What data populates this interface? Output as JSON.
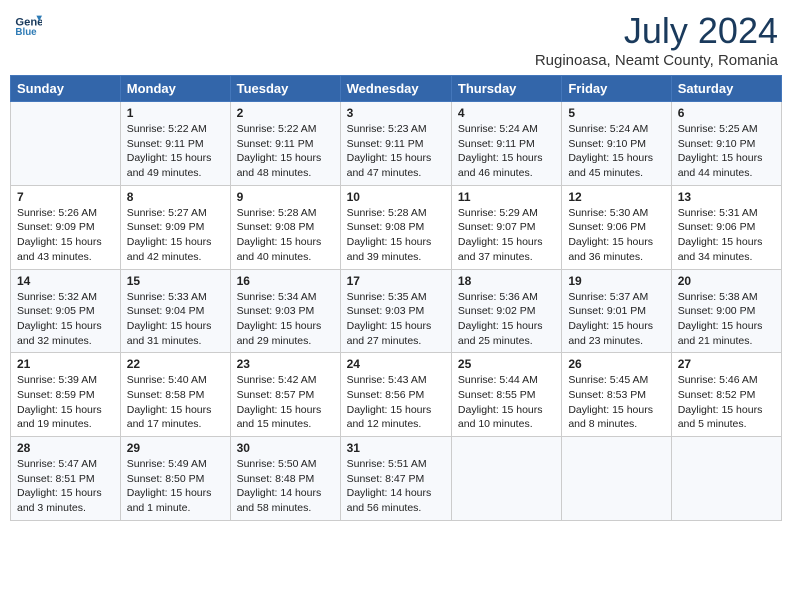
{
  "header": {
    "logo_line1": "General",
    "logo_line2": "Blue",
    "month_year": "July 2024",
    "location": "Ruginoasa, Neamt County, Romania"
  },
  "days_of_week": [
    "Sunday",
    "Monday",
    "Tuesday",
    "Wednesday",
    "Thursday",
    "Friday",
    "Saturday"
  ],
  "weeks": [
    [
      {
        "day": "",
        "info": ""
      },
      {
        "day": "1",
        "info": "Sunrise: 5:22 AM\nSunset: 9:11 PM\nDaylight: 15 hours\nand 49 minutes."
      },
      {
        "day": "2",
        "info": "Sunrise: 5:22 AM\nSunset: 9:11 PM\nDaylight: 15 hours\nand 48 minutes."
      },
      {
        "day": "3",
        "info": "Sunrise: 5:23 AM\nSunset: 9:11 PM\nDaylight: 15 hours\nand 47 minutes."
      },
      {
        "day": "4",
        "info": "Sunrise: 5:24 AM\nSunset: 9:11 PM\nDaylight: 15 hours\nand 46 minutes."
      },
      {
        "day": "5",
        "info": "Sunrise: 5:24 AM\nSunset: 9:10 PM\nDaylight: 15 hours\nand 45 minutes."
      },
      {
        "day": "6",
        "info": "Sunrise: 5:25 AM\nSunset: 9:10 PM\nDaylight: 15 hours\nand 44 minutes."
      }
    ],
    [
      {
        "day": "7",
        "info": "Sunrise: 5:26 AM\nSunset: 9:09 PM\nDaylight: 15 hours\nand 43 minutes."
      },
      {
        "day": "8",
        "info": "Sunrise: 5:27 AM\nSunset: 9:09 PM\nDaylight: 15 hours\nand 42 minutes."
      },
      {
        "day": "9",
        "info": "Sunrise: 5:28 AM\nSunset: 9:08 PM\nDaylight: 15 hours\nand 40 minutes."
      },
      {
        "day": "10",
        "info": "Sunrise: 5:28 AM\nSunset: 9:08 PM\nDaylight: 15 hours\nand 39 minutes."
      },
      {
        "day": "11",
        "info": "Sunrise: 5:29 AM\nSunset: 9:07 PM\nDaylight: 15 hours\nand 37 minutes."
      },
      {
        "day": "12",
        "info": "Sunrise: 5:30 AM\nSunset: 9:06 PM\nDaylight: 15 hours\nand 36 minutes."
      },
      {
        "day": "13",
        "info": "Sunrise: 5:31 AM\nSunset: 9:06 PM\nDaylight: 15 hours\nand 34 minutes."
      }
    ],
    [
      {
        "day": "14",
        "info": "Sunrise: 5:32 AM\nSunset: 9:05 PM\nDaylight: 15 hours\nand 32 minutes."
      },
      {
        "day": "15",
        "info": "Sunrise: 5:33 AM\nSunset: 9:04 PM\nDaylight: 15 hours\nand 31 minutes."
      },
      {
        "day": "16",
        "info": "Sunrise: 5:34 AM\nSunset: 9:03 PM\nDaylight: 15 hours\nand 29 minutes."
      },
      {
        "day": "17",
        "info": "Sunrise: 5:35 AM\nSunset: 9:03 PM\nDaylight: 15 hours\nand 27 minutes."
      },
      {
        "day": "18",
        "info": "Sunrise: 5:36 AM\nSunset: 9:02 PM\nDaylight: 15 hours\nand 25 minutes."
      },
      {
        "day": "19",
        "info": "Sunrise: 5:37 AM\nSunset: 9:01 PM\nDaylight: 15 hours\nand 23 minutes."
      },
      {
        "day": "20",
        "info": "Sunrise: 5:38 AM\nSunset: 9:00 PM\nDaylight: 15 hours\nand 21 minutes."
      }
    ],
    [
      {
        "day": "21",
        "info": "Sunrise: 5:39 AM\nSunset: 8:59 PM\nDaylight: 15 hours\nand 19 minutes."
      },
      {
        "day": "22",
        "info": "Sunrise: 5:40 AM\nSunset: 8:58 PM\nDaylight: 15 hours\nand 17 minutes."
      },
      {
        "day": "23",
        "info": "Sunrise: 5:42 AM\nSunset: 8:57 PM\nDaylight: 15 hours\nand 15 minutes."
      },
      {
        "day": "24",
        "info": "Sunrise: 5:43 AM\nSunset: 8:56 PM\nDaylight: 15 hours\nand 12 minutes."
      },
      {
        "day": "25",
        "info": "Sunrise: 5:44 AM\nSunset: 8:55 PM\nDaylight: 15 hours\nand 10 minutes."
      },
      {
        "day": "26",
        "info": "Sunrise: 5:45 AM\nSunset: 8:53 PM\nDaylight: 15 hours\nand 8 minutes."
      },
      {
        "day": "27",
        "info": "Sunrise: 5:46 AM\nSunset: 8:52 PM\nDaylight: 15 hours\nand 5 minutes."
      }
    ],
    [
      {
        "day": "28",
        "info": "Sunrise: 5:47 AM\nSunset: 8:51 PM\nDaylight: 15 hours\nand 3 minutes."
      },
      {
        "day": "29",
        "info": "Sunrise: 5:49 AM\nSunset: 8:50 PM\nDaylight: 15 hours\nand 1 minute."
      },
      {
        "day": "30",
        "info": "Sunrise: 5:50 AM\nSunset: 8:48 PM\nDaylight: 14 hours\nand 58 minutes."
      },
      {
        "day": "31",
        "info": "Sunrise: 5:51 AM\nSunset: 8:47 PM\nDaylight: 14 hours\nand 56 minutes."
      },
      {
        "day": "",
        "info": ""
      },
      {
        "day": "",
        "info": ""
      },
      {
        "day": "",
        "info": ""
      }
    ]
  ]
}
